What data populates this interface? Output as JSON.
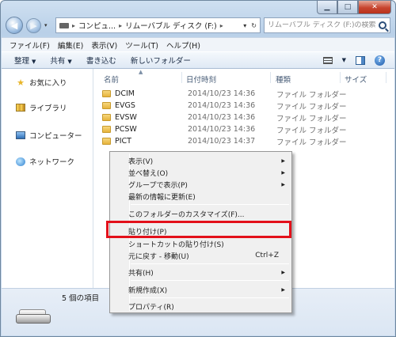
{
  "address": {
    "crumbs": [
      "コンピュ...",
      "リムーバブル ディスク (F:)"
    ],
    "search_placeholder": "リムーバブル ディスク (F:)の検索"
  },
  "menu": [
    "ファイル(F)",
    "編集(E)",
    "表示(V)",
    "ツール(T)",
    "ヘルプ(H)"
  ],
  "toolbar": {
    "organize": "整理",
    "share": "共有",
    "burn": "書き込む",
    "new_folder": "新しいフォルダー"
  },
  "nav": {
    "favorites": "お気に入り",
    "libraries": "ライブラリ",
    "computer": "コンピューター",
    "network": "ネットワーク"
  },
  "columns": {
    "name": "名前",
    "date": "日付時刻",
    "type": "種類",
    "size": "サイズ"
  },
  "files": [
    {
      "name": "DCIM",
      "date": "2014/10/23 14:36",
      "type": "ファイル フォルダー"
    },
    {
      "name": "EVGS",
      "date": "2014/10/23 14:36",
      "type": "ファイル フォルダー"
    },
    {
      "name": "EVSW",
      "date": "2014/10/23 14:36",
      "type": "ファイル フォルダー"
    },
    {
      "name": "PCSW",
      "date": "2014/10/23 14:36",
      "type": "ファイル フォルダー"
    },
    {
      "name": "PICT",
      "date": "2014/10/23 14:37",
      "type": "ファイル フォルダー"
    }
  ],
  "details": {
    "count": "5 個の項目"
  },
  "context_menu": {
    "view": "表示(V)",
    "sort": "並べ替え(O)",
    "group": "グループで表示(P)",
    "refresh": "最新の情報に更新(E)",
    "customize": "このフォルダーのカスタマイズ(F)...",
    "paste": "貼り付け(P)",
    "paste_shortcut": "ショートカットの貼り付け(S)",
    "undo_move": "元に戻す - 移動(U)",
    "undo_shortcut": "Ctrl+Z",
    "share": "共有(H)",
    "new": "新規作成(X)",
    "properties": "プロパティ(R)"
  },
  "colors": {
    "highlight": "#e3101a"
  }
}
